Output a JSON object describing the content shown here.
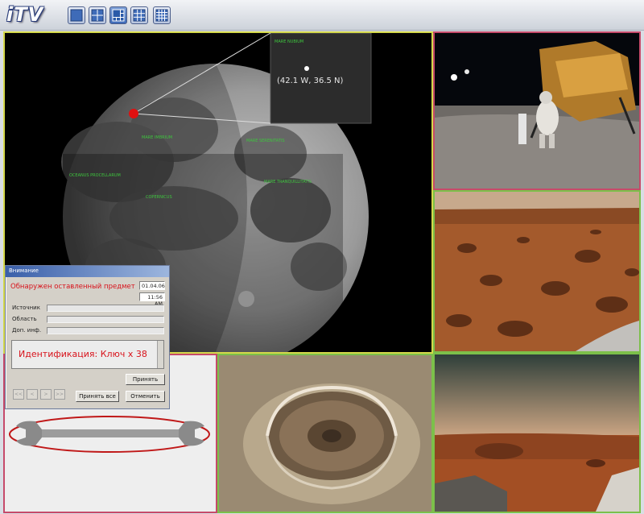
{
  "app": {
    "logo": "iTV"
  },
  "toolbar": {
    "layouts": [
      {
        "name": "layout-1x1",
        "active": false
      },
      {
        "name": "layout-2x2",
        "active": false
      },
      {
        "name": "layout-1plus5",
        "active": true
      },
      {
        "name": "layout-3x3",
        "active": false
      },
      {
        "name": "layout-4x4",
        "active": false
      }
    ]
  },
  "cells": {
    "main": {
      "border_color": "#d4d84a",
      "content": "moon",
      "annotation_coords": "(42.1 W, 36.5 N)",
      "labels": [
        "MARE NUBIUM",
        "MARE IMBRIUM",
        "MARE SERENITATIS",
        "OCEANUS PROCELLARUM",
        "COPERNICUS",
        "MARE TRANQUILLITATIS"
      ]
    },
    "top_right": {
      "border_color": "#c64a6a",
      "content": "lunar-landing"
    },
    "mid_right": {
      "border_color": "#7cc04a",
      "content": "mars-surface-rocks"
    },
    "bottom_left": {
      "border_color": "#c64a6a",
      "content": "wrench"
    },
    "bottom_center": {
      "border_color": "#7cc04a",
      "content": "mars-crater"
    },
    "bottom_right": {
      "border_color": "#7cc04a",
      "content": "mars-horizon"
    }
  },
  "dialog": {
    "title": "Внимание",
    "alert": "Обнаружен оставленный предмет",
    "date": "01.04.06",
    "time": "11:56 AM",
    "source_label": "Источник",
    "area_label": "Область",
    "extra_label": "Доп. инф.",
    "identification": "Идентификация: Ключ х 38",
    "accept": "Принять",
    "accept_all": "Принять все",
    "cancel": "Отменить",
    "nav": [
      "<<",
      "<",
      ">",
      ">>"
    ]
  },
  "colors": {
    "alert_red": "#d8121b",
    "accent": "#3a5fa9"
  }
}
